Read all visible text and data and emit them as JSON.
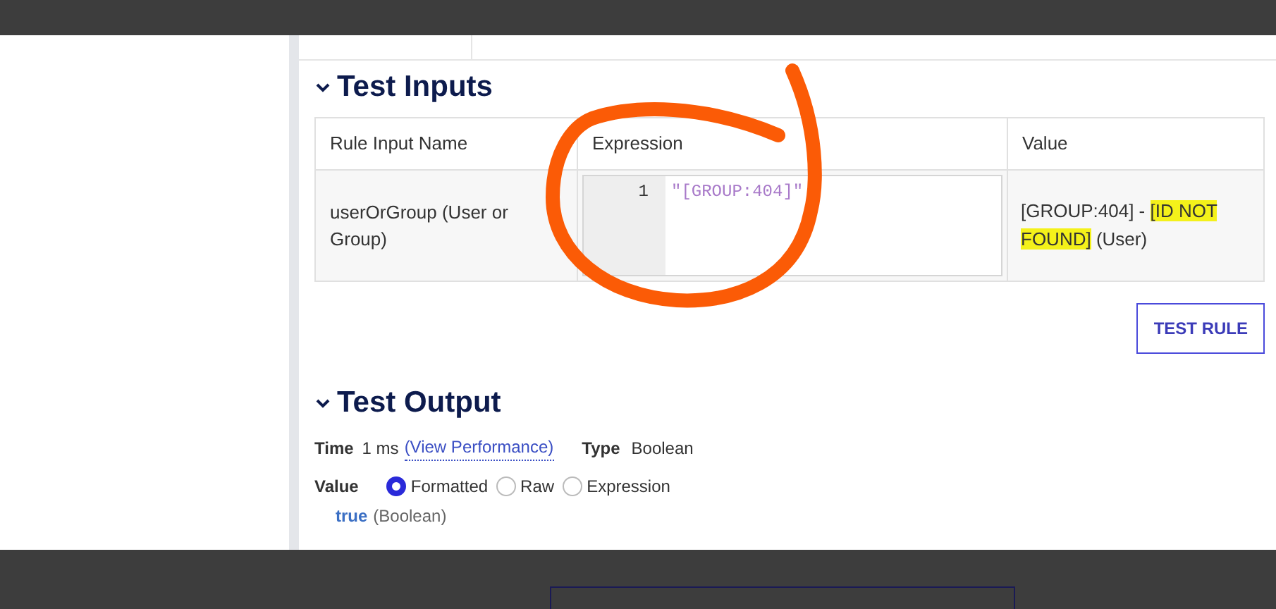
{
  "inputs": {
    "title": "Test Inputs",
    "expanded": true,
    "columns": [
      "Rule Input Name",
      "Expression",
      "Value"
    ],
    "rows": [
      {
        "name": "userOrGroup (User or Group)",
        "line": "1",
        "expression": "\"[GROUP:404]\"",
        "value_prefix": "[GROUP:404] -",
        "value_highlight": "[ID NOT FOUND]",
        "value_suffix": "(User)"
      }
    ],
    "button": "TEST RULE"
  },
  "output": {
    "title": "Test Output",
    "expanded": true,
    "time_label": "Time",
    "time": "1 ms",
    "link": "(View Performance)",
    "type_label": "Type",
    "type": "Boolean",
    "value_label": "Value",
    "options": [
      {
        "label": "Formatted",
        "selected": true
      },
      {
        "label": "Raw",
        "selected": false
      },
      {
        "label": "Expression",
        "selected": false
      }
    ],
    "result": "true",
    "result_type": "(Boolean)"
  }
}
